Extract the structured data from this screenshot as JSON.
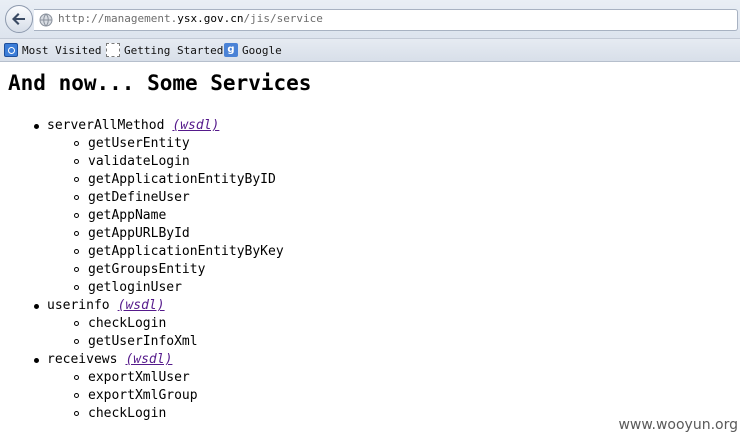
{
  "browser": {
    "url_prefix": "http://management.",
    "url_domain": "ysx.gov.cn",
    "url_path": "/jis/service",
    "bookmarks": [
      {
        "label": "Most Visited",
        "icon": "most-visited-icon"
      },
      {
        "label": "Getting Started",
        "icon": "getting-started-icon"
      },
      {
        "label": "Google",
        "icon": "google-icon"
      }
    ]
  },
  "page": {
    "title": "And now... Some Services",
    "services": [
      {
        "name": "serverAllMethod",
        "wsdl_label": "(wsdl)",
        "operations": [
          "getUserEntity",
          "validateLogin",
          "getApplicationEntityByID",
          "getDefineUser",
          "getAppName",
          "getAppURLById",
          "getApplicationEntityByKey",
          "getGroupsEntity",
          "getloginUser"
        ]
      },
      {
        "name": "userinfo",
        "wsdl_label": "(wsdl)",
        "operations": [
          "checkLogin",
          "getUserInfoXml"
        ]
      },
      {
        "name": "receivews",
        "wsdl_label": "(wsdl)",
        "operations": [
          "exportXmlUser",
          "exportXmlGroup",
          "checkLogin"
        ]
      }
    ]
  },
  "watermark": "www.wooyun.org",
  "colors": {
    "link_visited": "#551a8b",
    "chrome_bg": "#dde4ee"
  }
}
